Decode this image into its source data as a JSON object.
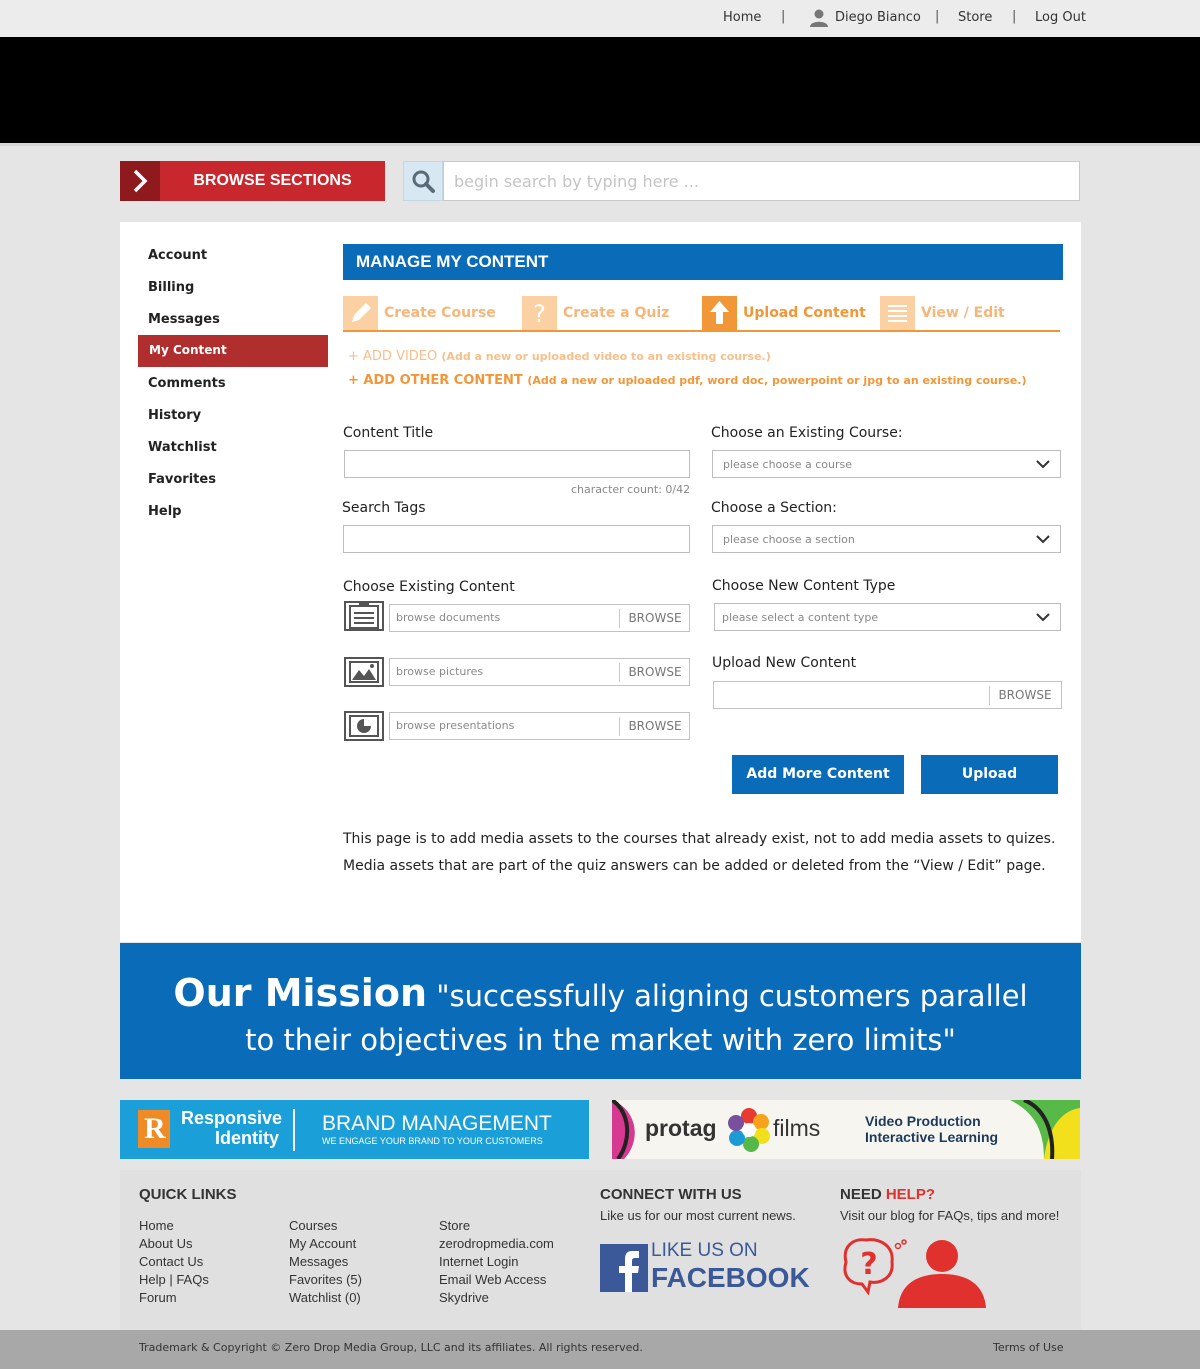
{
  "topnav": {
    "home": "Home",
    "user": "Diego Bianco",
    "store": "Store",
    "logout": "Log Out",
    "separator": "|"
  },
  "browse": {
    "label": "BROWSE SECTIONS"
  },
  "search": {
    "placeholder": "begin search by typing here ..."
  },
  "sidebar": {
    "items": [
      {
        "label": "Account"
      },
      {
        "label": "Billing"
      },
      {
        "label": "Messages"
      },
      {
        "label": "My Content",
        "active": true
      },
      {
        "label": "Comments"
      },
      {
        "label": "History"
      },
      {
        "label": "Watchlist"
      },
      {
        "label": "Favorites"
      },
      {
        "label": "Help"
      }
    ]
  },
  "manage": {
    "title": "MANAGE MY CONTENT",
    "tabs": [
      {
        "label": "Create Course",
        "icon": "pencil-icon"
      },
      {
        "label": "Create a Quiz",
        "icon": "question-icon"
      },
      {
        "label": "Upload Content",
        "icon": "upload-arrow-icon",
        "active": true
      },
      {
        "label": "View / Edit",
        "icon": "list-icon"
      }
    ],
    "add_video": {
      "label": "+ ADD VIDEO",
      "note": "(Add a new or uploaded video to an existing course.)"
    },
    "add_other": {
      "label": "+ ADD OTHER CONTENT",
      "note": "(Add a new or uploaded pdf, word doc, powerpoint or jpg to an existing course.)"
    }
  },
  "form": {
    "content_title": {
      "label": "Content Title",
      "value": ""
    },
    "char_count": "character count: 0/42",
    "search_tags": {
      "label": "Search Tags",
      "value": ""
    },
    "existing_course": {
      "label": "Choose an Existing Course:",
      "value": "please choose a course"
    },
    "section": {
      "label": "Choose a Section:",
      "value": "please choose a section"
    },
    "existing_content": {
      "label": "Choose Existing Content",
      "rows": [
        {
          "placeholder": "browse documents",
          "button": "BROWSE",
          "icon": "document-icon"
        },
        {
          "placeholder": "browse pictures",
          "button": "BROWSE",
          "icon": "picture-icon"
        },
        {
          "placeholder": "browse presentations",
          "button": "BROWSE",
          "icon": "presentation-icon"
        }
      ]
    },
    "new_content_type": {
      "label": "Choose New Content Type",
      "value": "please select a content type"
    },
    "upload_new": {
      "label": "Upload  New Content",
      "button": "BROWSE"
    },
    "add_more_button": "Add More Content",
    "upload_button": "Upload"
  },
  "info": {
    "line1": "This page is to add media assets to the courses that already exist, not to add media assets to quizes.",
    "line2": "Media assets that are part of the quiz answers can be added or deleted from the “View / Edit” page."
  },
  "mission": {
    "heading": "Our Mission",
    "quote_line1": "\"successfully aligning customers parallel",
    "quote_line2": "to their objectives in the market with zero limits\""
  },
  "ads": {
    "responsive": {
      "logo_letter": "R",
      "name_line1": "Responsive",
      "name_line2": "Identity",
      "headline": "BRAND MANAGEMENT",
      "tagline": "WE ENGAGE YOUR BRAND TO YOUR CUSTOMERS"
    },
    "protag": {
      "name_left": "protag",
      "name_right": "films",
      "line1": "Video Production",
      "line2": "Interactive Learning"
    }
  },
  "footer": {
    "quick_links_title": "QUICK LINKS",
    "col1": [
      "Home",
      "About Us",
      "Contact Us",
      "Help | FAQs",
      "Forum"
    ],
    "col2": [
      "Courses",
      "My Account",
      "Messages",
      "Favorites (5)",
      "Watchlist (0)"
    ],
    "col3": [
      "Store",
      "zerodropmedia.com",
      "Internet Login",
      "Email Web Access",
      "Skydrive"
    ],
    "connect_title": "CONNECT WITH US",
    "connect_sub": "Like us for our most current news.",
    "facebook_line1": "LIKE US ON",
    "facebook_line2": "FACEBOOK",
    "help_title_a": "NEED ",
    "help_title_b": "HELP?",
    "help_sub": "Visit our blog for FAQs, tips and more!",
    "copyright": "Trademark & Copyright © Zero Drop Media Group, LLC and its affiliates. All rights reserved.",
    "terms": "Terms of Use"
  },
  "colors": {
    "brand_blue": "#0a6bb8",
    "brand_red": "#c8272d",
    "accent_orange": "#f29738",
    "sidebar_active": "#b02e2e"
  }
}
